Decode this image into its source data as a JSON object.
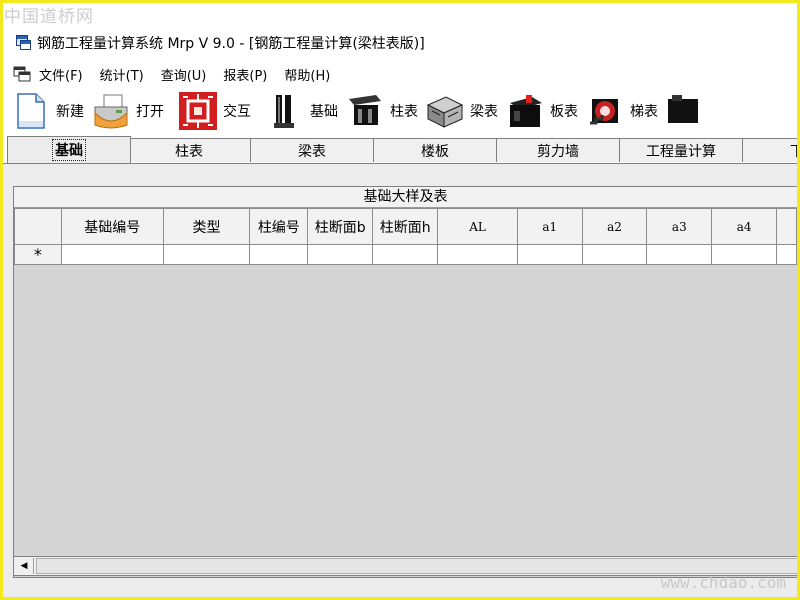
{
  "watermark": {
    "site_name": "中国道桥网",
    "url": "www.chdao.com"
  },
  "window": {
    "title": "钢筋工程量计算系统 Mrp V 9.0 - [钢筋工程量计算(梁柱表版)]"
  },
  "menu": [
    {
      "id": "file",
      "label": "文件(F)"
    },
    {
      "id": "stats",
      "label": "统计(T)"
    },
    {
      "id": "query",
      "label": "查询(U)"
    },
    {
      "id": "report",
      "label": "报表(P)"
    },
    {
      "id": "help",
      "label": "帮助(H)"
    }
  ],
  "toolbar": [
    {
      "id": "new",
      "label": "新建",
      "icon": "new-document-icon"
    },
    {
      "id": "open",
      "label": "打开",
      "icon": "open-printer-icon"
    },
    {
      "id": "interact",
      "label": "交互",
      "icon": "interact-chip-icon"
    },
    {
      "id": "foundation",
      "label": "基础",
      "icon": "foundation-icon"
    },
    {
      "id": "column",
      "label": "柱表",
      "icon": "column-table-icon"
    },
    {
      "id": "beam",
      "label": "梁表",
      "icon": "beam-table-icon"
    },
    {
      "id": "slab",
      "label": "板表",
      "icon": "slab-table-icon"
    },
    {
      "id": "stair",
      "label": "梯表",
      "icon": "stair-table-icon"
    }
  ],
  "tabs": [
    {
      "id": "foundation",
      "label": "基础",
      "active": true
    },
    {
      "id": "column",
      "label": "柱表"
    },
    {
      "id": "beam",
      "label": "梁表"
    },
    {
      "id": "slab",
      "label": "楼板"
    },
    {
      "id": "shearwall",
      "label": "剪力墙"
    },
    {
      "id": "quantity",
      "label": "工程量计算"
    },
    {
      "id": "more",
      "label": "下程"
    }
  ],
  "grid": {
    "caption": "基础大样及表",
    "columns": [
      "基础编号",
      "类型",
      "柱编号",
      "柱断面b",
      "柱断面h",
      "AL",
      "a1",
      "a2",
      "a3",
      "a4"
    ],
    "new_row_marker": "*"
  },
  "colors": {
    "frame": "#f2ea1c",
    "toolbar_red": "#d21e1e",
    "panel": "#ececec"
  }
}
